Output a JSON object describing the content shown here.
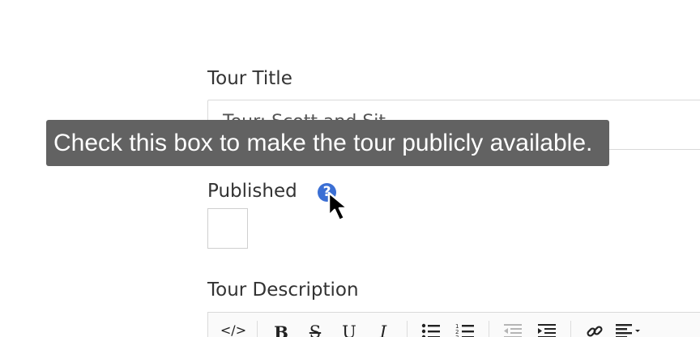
{
  "form": {
    "title_label": "Tour Title",
    "title_value": "Tour: Scott and Sit...",
    "published_label": "Published",
    "published_checked": false,
    "description_label": "Tour Description"
  },
  "tooltip": {
    "text": "Check this box to make the tour publicly available."
  },
  "help_icon": {
    "glyph": "?",
    "icon": "question-circle-icon"
  },
  "toolbar": {
    "code": "</>",
    "bold": "B",
    "strike": "S",
    "underline": "U",
    "italic": "I",
    "unordered_list_icon": "unordered-list-icon",
    "ordered_list_icon": "ordered-list-icon",
    "outdent_icon": "outdent-icon",
    "indent_icon": "indent-icon",
    "link_icon": "link-icon",
    "align_icon": "align-icon"
  }
}
